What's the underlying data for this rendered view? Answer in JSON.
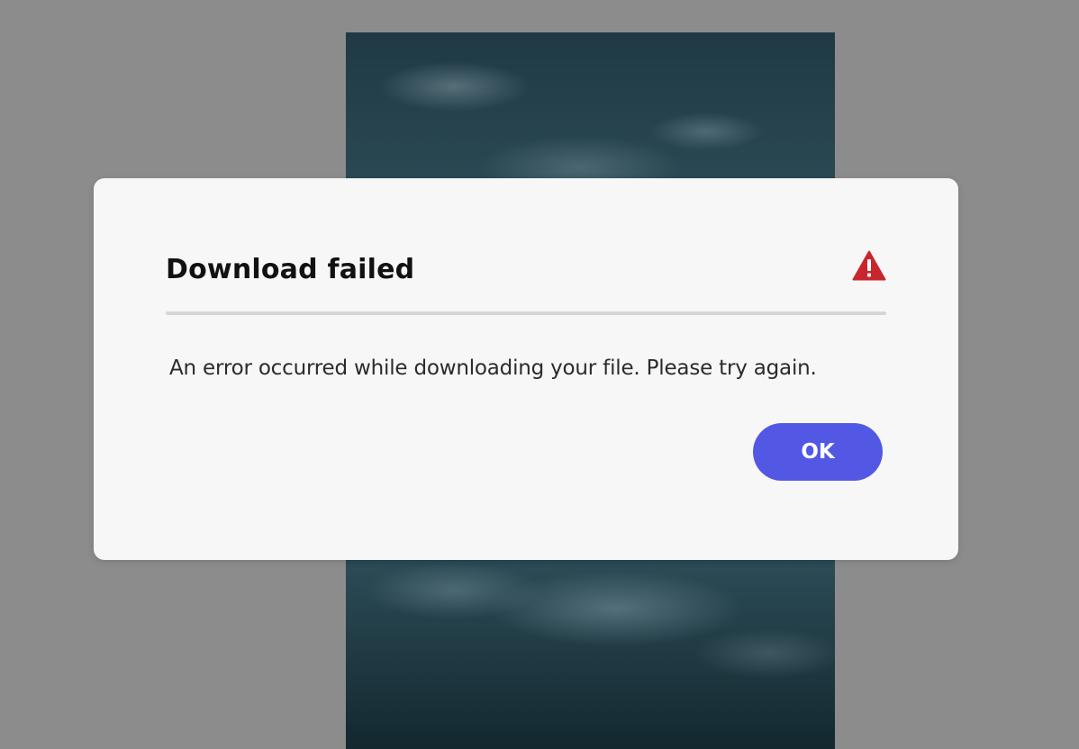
{
  "dialog": {
    "title": "Download failed",
    "message": "An error occurred while downloading your file. Please try again.",
    "ok_label": "OK",
    "alert_icon": "alert-triangle-icon"
  },
  "colors": {
    "overlay": "#8c8c8c",
    "dialog_background": "#f7f7f7",
    "alert_red": "#c9252d",
    "button_blue": "#5258e4"
  }
}
